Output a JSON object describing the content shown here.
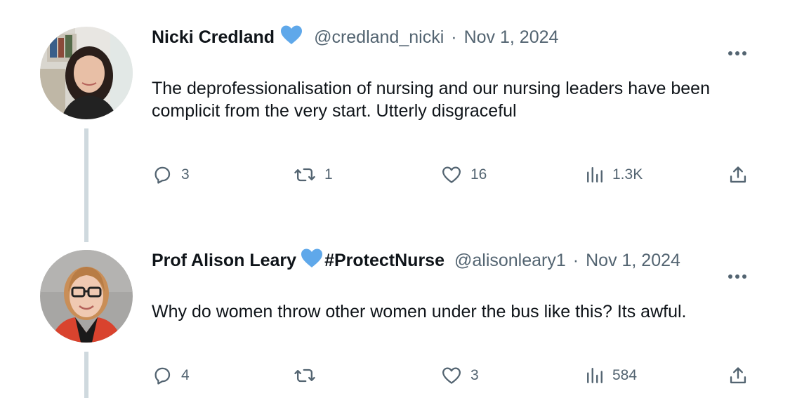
{
  "tweets": [
    {
      "author_name": "Nicki Credland",
      "verified_badge": "blue-heart-emoji",
      "handle": "@credland_nicki",
      "separator": "·",
      "date": "Nov 1, 2024",
      "text": "The deprofessionalisation of nursing and our nursing leaders have been complicit from the very start. Utterly disgraceful",
      "replies": "3",
      "retweets": "1",
      "likes": "16",
      "views": "1.3K"
    },
    {
      "author_name": "Prof Alison Leary",
      "verified_badge": "blue-heart-emoji",
      "name_suffix": "#ProtectNurse",
      "handle": "@alisonleary1",
      "separator": "·",
      "date": "Nov 1, 2024",
      "text": "Why do women throw other women under the bus like this? Its awful.",
      "replies": "4",
      "retweets": "",
      "likes": "3",
      "views": "584"
    }
  ],
  "icons": {
    "reply": "speech-bubble-icon",
    "retweet": "repost-arrows-icon",
    "like": "heart-outline-icon",
    "views": "bar-chart-icon",
    "share": "upload-share-icon",
    "more": "ellipsis-icon"
  },
  "colors": {
    "text_primary": "#0f1419",
    "text_secondary": "#536471",
    "heart_blue": "#5fa8ea",
    "thread_line": "#cfd9de"
  }
}
